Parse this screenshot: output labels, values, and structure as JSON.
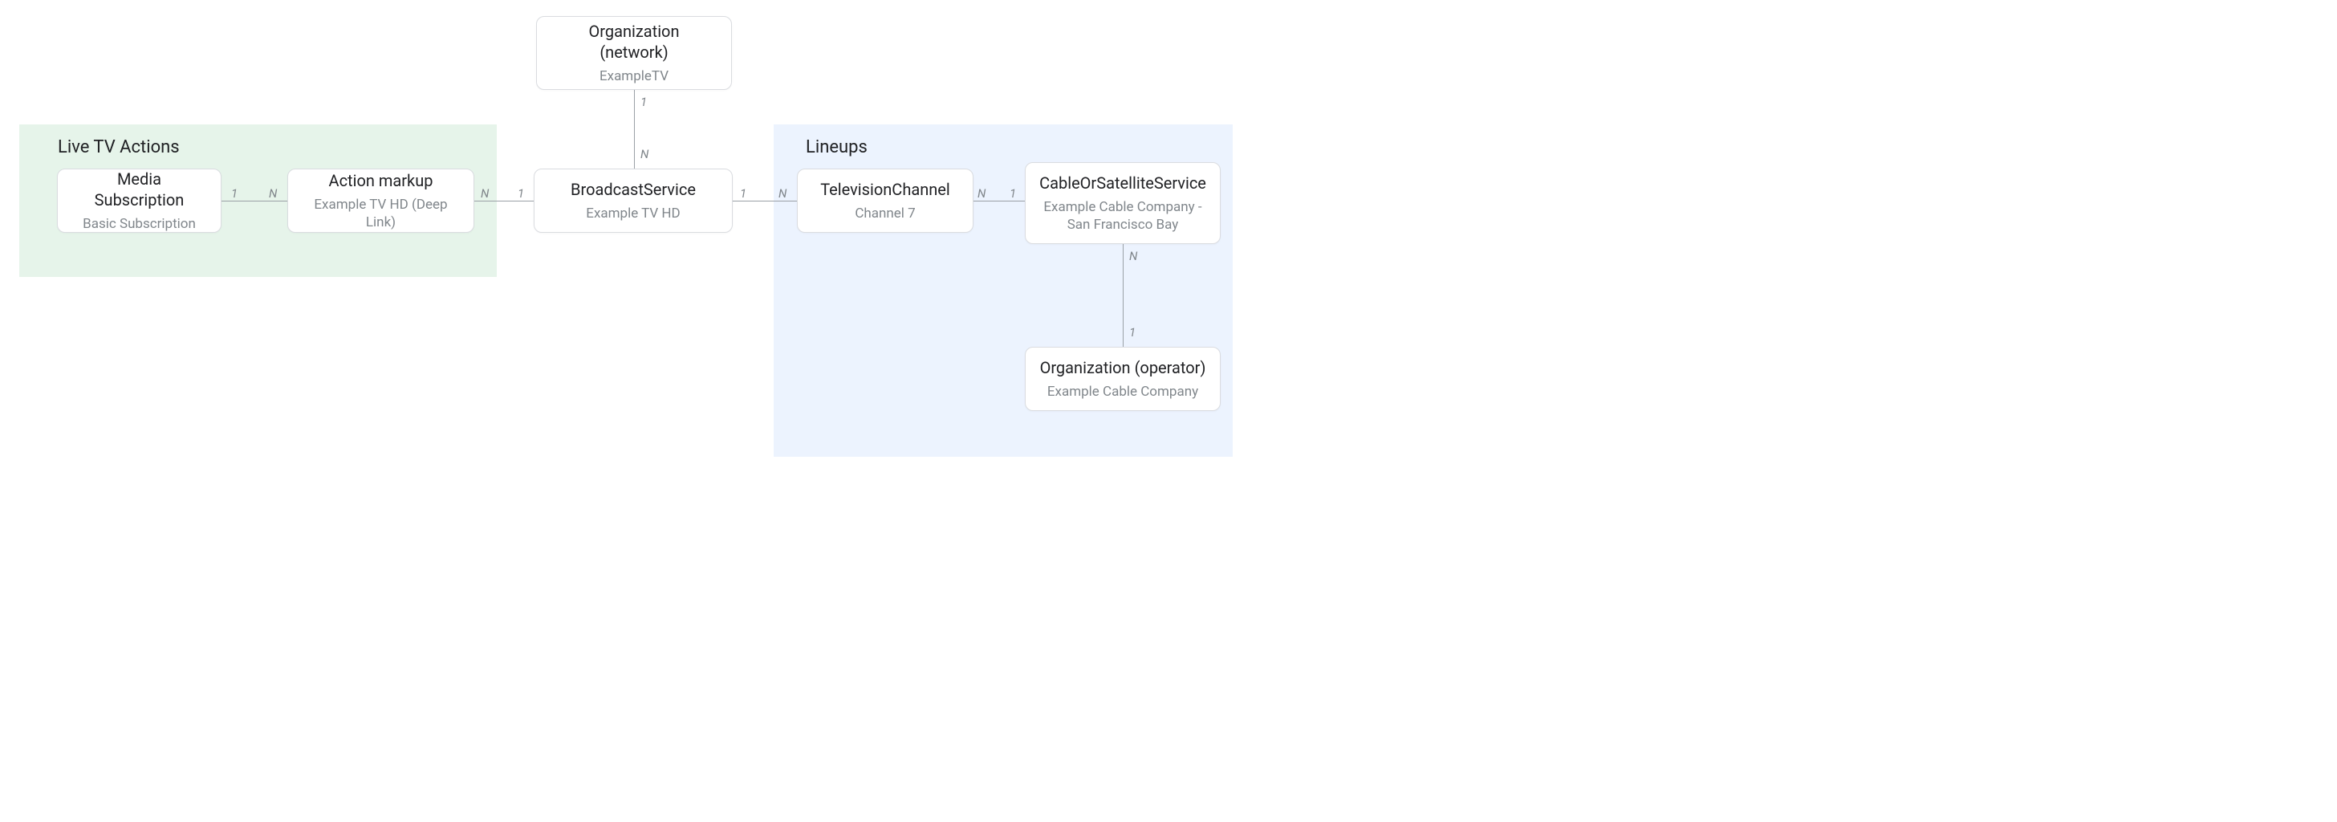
{
  "regions": {
    "live": "Live TV Actions",
    "lineups": "Lineups"
  },
  "boxes": {
    "org_network": {
      "title": "Organization\n(network)",
      "sub": "ExampleTV"
    },
    "media_sub": {
      "title": "Media Subscription",
      "sub": "Basic Subscription"
    },
    "action_mk": {
      "title": "Action markup",
      "sub": "Example TV HD (Deep Link)"
    },
    "broadcast": {
      "title": "BroadcastService",
      "sub": "Example TV HD"
    },
    "tv_channel": {
      "title": "TelevisionChannel",
      "sub": "Channel 7"
    },
    "cable_sat": {
      "title": "CableOrSatelliteService",
      "sub": "Example Cable Company - San Francisco Bay"
    },
    "org_op": {
      "title": "Organization (operator)",
      "sub": "Example Cable Company"
    }
  },
  "card": {
    "one": "1",
    "many": "N"
  }
}
